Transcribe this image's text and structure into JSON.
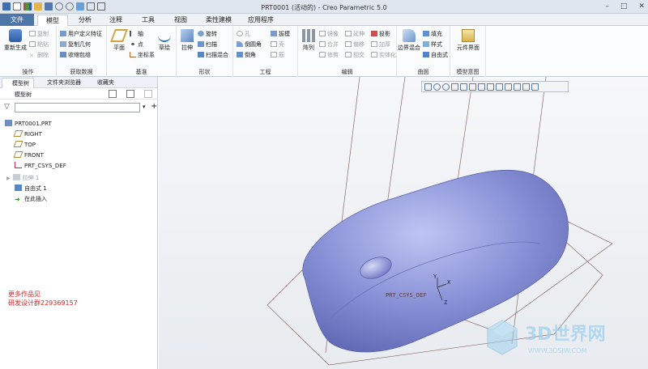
{
  "window": {
    "title": "PRT0001 (活动的) - Creo Parametric 5.0"
  },
  "tabs": [
    "文件",
    "模型",
    "分析",
    "注释",
    "工具",
    "视图",
    "柔性建模",
    "应用程序"
  ],
  "ribbon": {
    "ops": {
      "regen": "重新生成",
      "copy": "复制",
      "paste": "粘贴",
      "delete": "删除",
      "label": "操作"
    },
    "getdata": {
      "udf": "用户定义特征",
      "copygeom": "复制几何",
      "shrink": "收缩包络",
      "label": "获取数据"
    },
    "datum": {
      "plane": "平面",
      "axis": "轴",
      "point": "点",
      "csys": "坐标系",
      "sketch": "草绘",
      "label": "基准"
    },
    "shapes": {
      "extrude": "拉伸",
      "revolve": "旋转",
      "sweep": "扫描",
      "helical": "扫描混合",
      "label": "形状"
    },
    "eng": {
      "hole": "孔",
      "round": "倒圆角",
      "chamfer": "倒角",
      "draft": "拔模",
      "shell": "壳",
      "rib": "筋",
      "label": "工程"
    },
    "edit": {
      "pattern": "阵列",
      "mirror": "镜像",
      "extend": "延伸",
      "project": "投影",
      "merge": "修剪",
      "offset": "偏移",
      "trim": "合并",
      "thicken": "加厚",
      "intersect": "相交",
      "solidify": "实体化",
      "label": "编辑"
    },
    "surfaces": {
      "boundary": "边界混合",
      "fill": "填充",
      "style": "样式",
      "freestyle": "自由式",
      "label": "曲面"
    },
    "intent": {
      "component": "元件界面",
      "label": "模型意图"
    }
  },
  "panel": {
    "tabs": [
      "模型树",
      "文件夹浏览器",
      "收藏夹"
    ],
    "header": "模型树",
    "tree": [
      "PRT0001.PRT",
      "RIGHT",
      "TOP",
      "FRONT",
      "PRT_CSYS_DEF",
      "拉伸 1",
      "自由式 1",
      "在此插入"
    ],
    "promo": [
      "更多作品见",
      "研发设计群229369157"
    ]
  },
  "viewport": {
    "csys_label": "PRT_CSYS_DEF",
    "axes": [
      "Y",
      "X",
      "Z"
    ]
  },
  "watermark": {
    "name": "3D世界网",
    "url": "WWW.3DSJW.COM"
  },
  "colors": {
    "accent": "#4d76a8",
    "body": "#8a93d8",
    "promo": "#dd2222"
  }
}
